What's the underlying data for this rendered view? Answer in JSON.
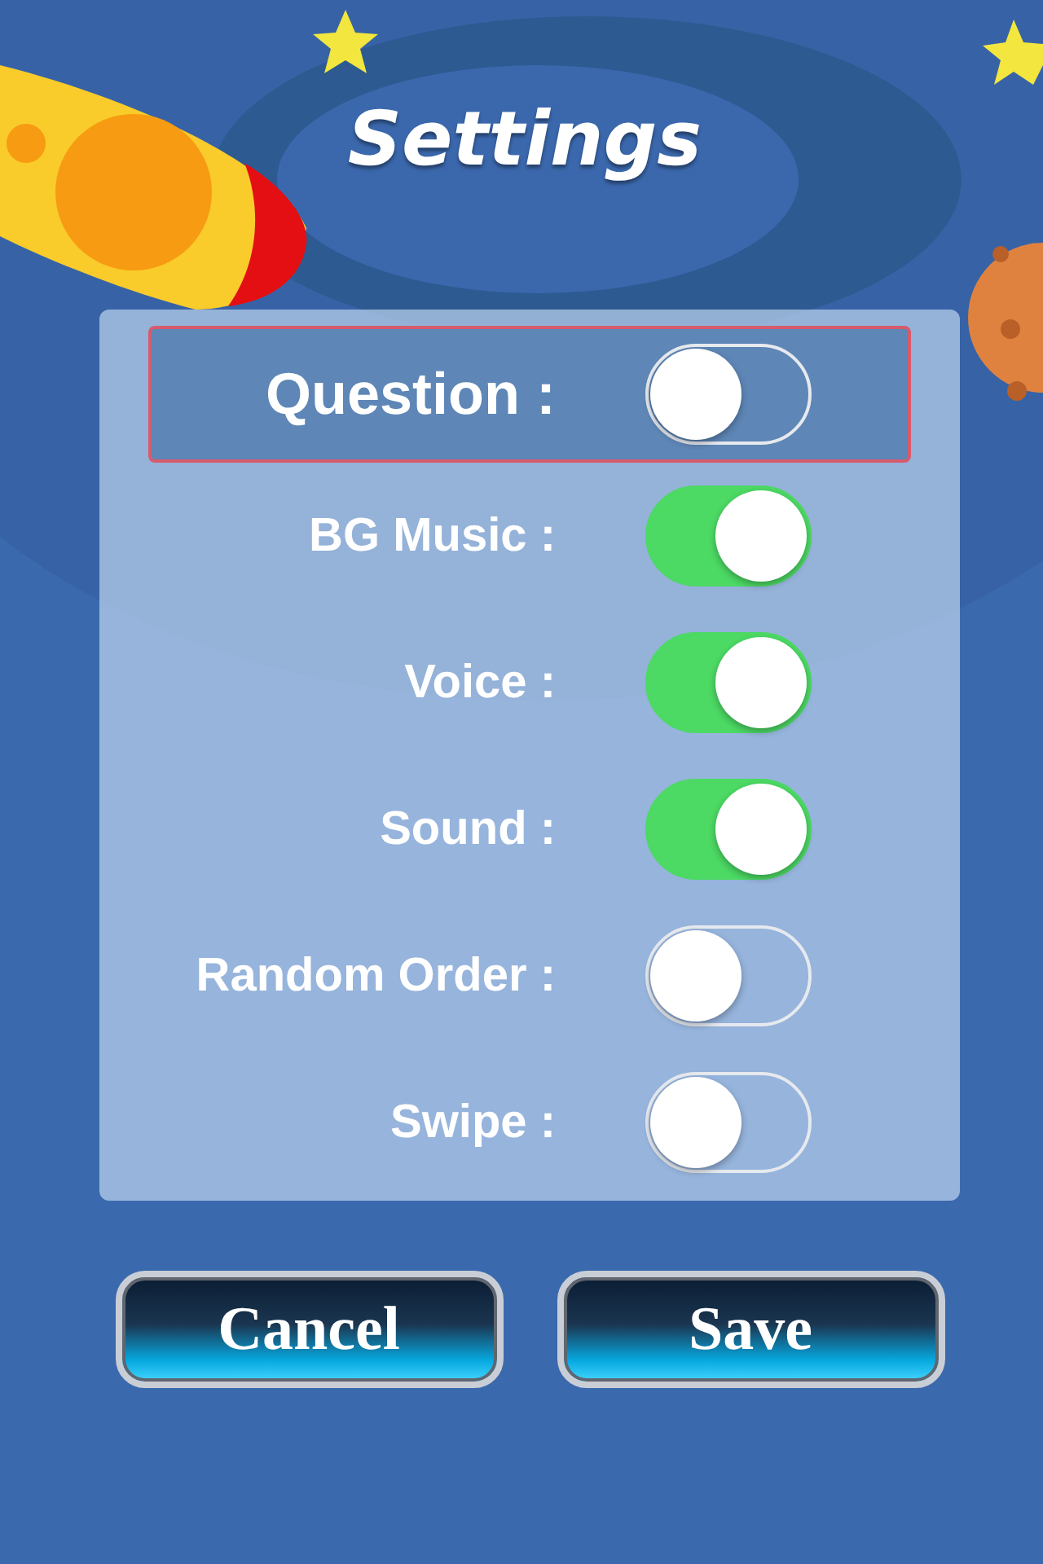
{
  "title": "Settings",
  "settings": [
    {
      "label": "Question :",
      "on": false,
      "selected": true
    },
    {
      "label": "BG Music :",
      "on": true,
      "selected": false
    },
    {
      "label": "Voice :",
      "on": true,
      "selected": false
    },
    {
      "label": "Sound :",
      "on": true,
      "selected": false
    },
    {
      "label": "Random Order :",
      "on": false,
      "selected": false
    },
    {
      "label": "Swipe :",
      "on": false,
      "selected": false
    }
  ],
  "buttons": [
    {
      "label": "Cancel"
    },
    {
      "label": "Save"
    }
  ]
}
